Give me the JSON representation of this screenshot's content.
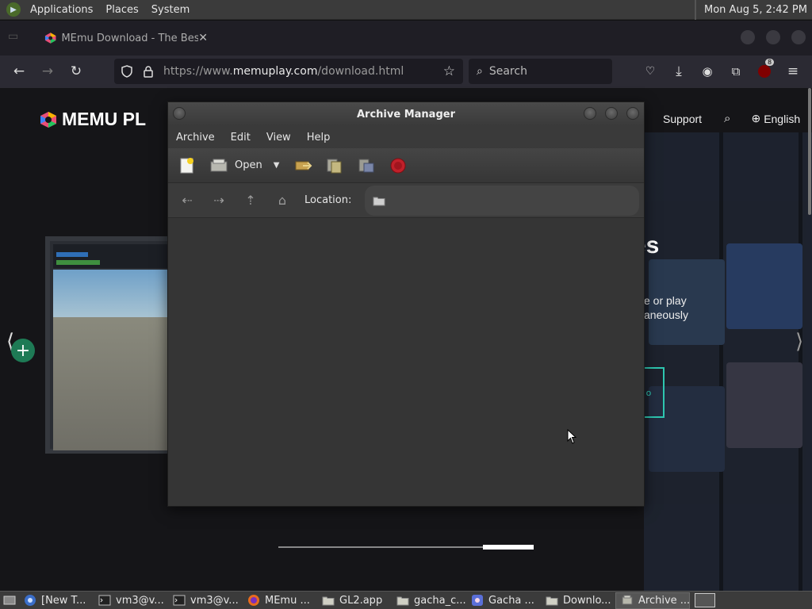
{
  "top_panel": {
    "menus": [
      "Applications",
      "Places",
      "System"
    ],
    "clock": "Mon Aug  5,  2:42 PM"
  },
  "browser": {
    "tab_title": "MEmu Download - The Best",
    "tab_close": "✕",
    "url_prefix": "https://www.",
    "url_host": "memuplay.com",
    "url_path": "/download.html",
    "search_placeholder": "Search",
    "extension_badge": "8"
  },
  "webpage": {
    "brand": "MEMU PL",
    "nav_support": "Support",
    "nav_language": "English",
    "hero_heading": "es",
    "hero_text1": "e or play",
    "hero_text2": "aneously",
    "hero_button": "o",
    "prev_arrow": "⟨",
    "next_arrow": "⟩",
    "plus": "+",
    "slider_progress": 0.2
  },
  "archive_manager": {
    "title": "Archive Manager",
    "menus": [
      "Archive",
      "Edit",
      "View",
      "Help"
    ],
    "toolbar_open": "Open",
    "location_label": "Location:",
    "location_value": ""
  },
  "taskbar": {
    "items": [
      {
        "label": "[New T...",
        "icon": "chrome-icon"
      },
      {
        "label": "vm3@v...",
        "icon": "terminal-icon"
      },
      {
        "label": "vm3@v...",
        "icon": "terminal-icon"
      },
      {
        "label": "MEmu ...",
        "icon": "firefox-icon"
      },
      {
        "label": "GL2.app",
        "icon": "folder-icon"
      },
      {
        "label": "gacha_c...",
        "icon": "folder-icon"
      },
      {
        "label": "Gacha ...",
        "icon": "app-icon"
      },
      {
        "label": "Downlo...",
        "icon": "folder-icon"
      },
      {
        "label": "Archive ...",
        "icon": "archive-icon"
      }
    ]
  },
  "colors": {
    "panel": "#3b3b3b",
    "browser_nav": "#2b2a33",
    "accent_teal": "#2ec6b0",
    "record_red": "#c0202a"
  }
}
